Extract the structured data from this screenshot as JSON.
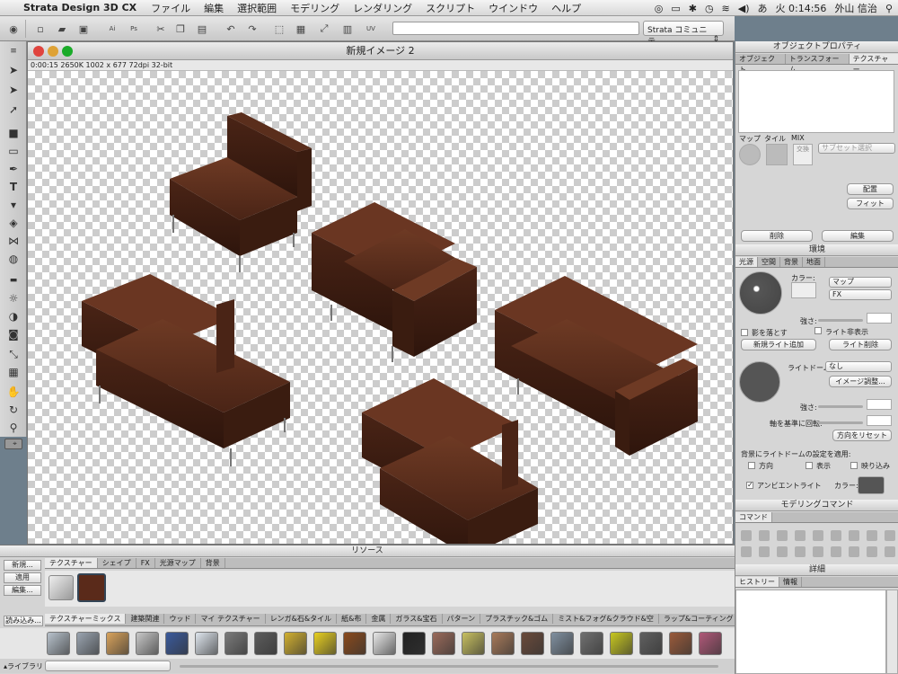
{
  "menubar": {
    "app_name": "Strata Design 3D CX",
    "items": [
      "ファイル",
      "編集",
      "選択範囲",
      "モデリング",
      "レンダリング",
      "スクリプト",
      "ウインドウ",
      "ヘルプ"
    ],
    "clock": "火 0:14:56",
    "user": "外山 信治",
    "ime": "あ"
  },
  "toolbar": {
    "community_select": "Strata コミュニテ..."
  },
  "document": {
    "title": "新規イメージ 2",
    "info": "0:00:15  2650K  1002 x 677  72dpi  32-bit"
  },
  "object_properties": {
    "title": "オブジェクトプロパティ",
    "tabs": [
      "オブジェクト",
      "トランスフォーム",
      "テクスチャー"
    ],
    "map_label": "マップ",
    "tile_label": "タイル",
    "mix_label": "MIX",
    "swap_label": "交換",
    "subset_select": "サブセット選択",
    "place_button": "配置",
    "fit_button": "フィット",
    "delete_button": "削除",
    "edit_button": "編集"
  },
  "environment": {
    "title": "環境",
    "tabs": [
      "光源",
      "空間",
      "背景",
      "地面"
    ],
    "color_label": "カラー:",
    "map_select": "マップ",
    "fx_select": "FX",
    "intensity_label": "強さ:",
    "cast_shadow": "影を落とす",
    "hide_light": "ライト非表示",
    "add_light_button": "新規ライト追加",
    "delete_light_button": "ライト削除",
    "light_dome_label": "ライトドーム:",
    "light_dome_value": "なし",
    "image_adjust_button": "イメージ調整...",
    "intensity2_label": "強さ:",
    "rotate_label": "軸を基準に回転:",
    "reset_direction_button": "方向をリセット",
    "apply_label": "背景にライトドームの設定を適用:",
    "apply_options": [
      "方向",
      "表示",
      "映り込み"
    ],
    "ambient_label": "アンビエントライト",
    "ambient_color_label": "カラー:"
  },
  "modeling_commands": {
    "title": "モデリングコマンド",
    "tab": "コマンド"
  },
  "details": {
    "title": "詳細",
    "tabs": [
      "ヒストリー",
      "情報"
    ]
  },
  "resources": {
    "title": "リソース",
    "tabs": [
      "テクスチャー",
      "シェイプ",
      "FX",
      "光源マップ",
      "背景"
    ],
    "side_buttons": [
      "新規...",
      "適用",
      "編集..."
    ],
    "load_button": "読み込み...",
    "library_label": "▴ライブラリ",
    "category_tabs": [
      "テクスチャーミックス",
      "建築関連",
      "ウッド",
      "マイ テクスチャー",
      "レンガ&石&タイル",
      "紙&布",
      "金属",
      "ガラス&宝石",
      "パターン",
      "プラスチック&ゴム",
      "ミスト&フォグ&クラウド&空",
      "ラップ&コーティング"
    ],
    "thumb_colors": [
      "#b8c2cc",
      "#9aa4b0",
      "#d9a35c",
      "#c8c8c8",
      "#3a5a9c",
      "#dfe6ee",
      "#7a7a7a",
      "#5c5c5c",
      "#d2b030",
      "#e8d020",
      "#8a4a1c",
      "#e8e8e8",
      "#222222",
      "#9a6a5a",
      "#c8c060",
      "#a87a5a",
      "#6a4a3a",
      "#8090a0",
      "#707070",
      "#c8c820",
      "#606060",
      "#9a5a3a",
      "#b05878"
    ]
  }
}
